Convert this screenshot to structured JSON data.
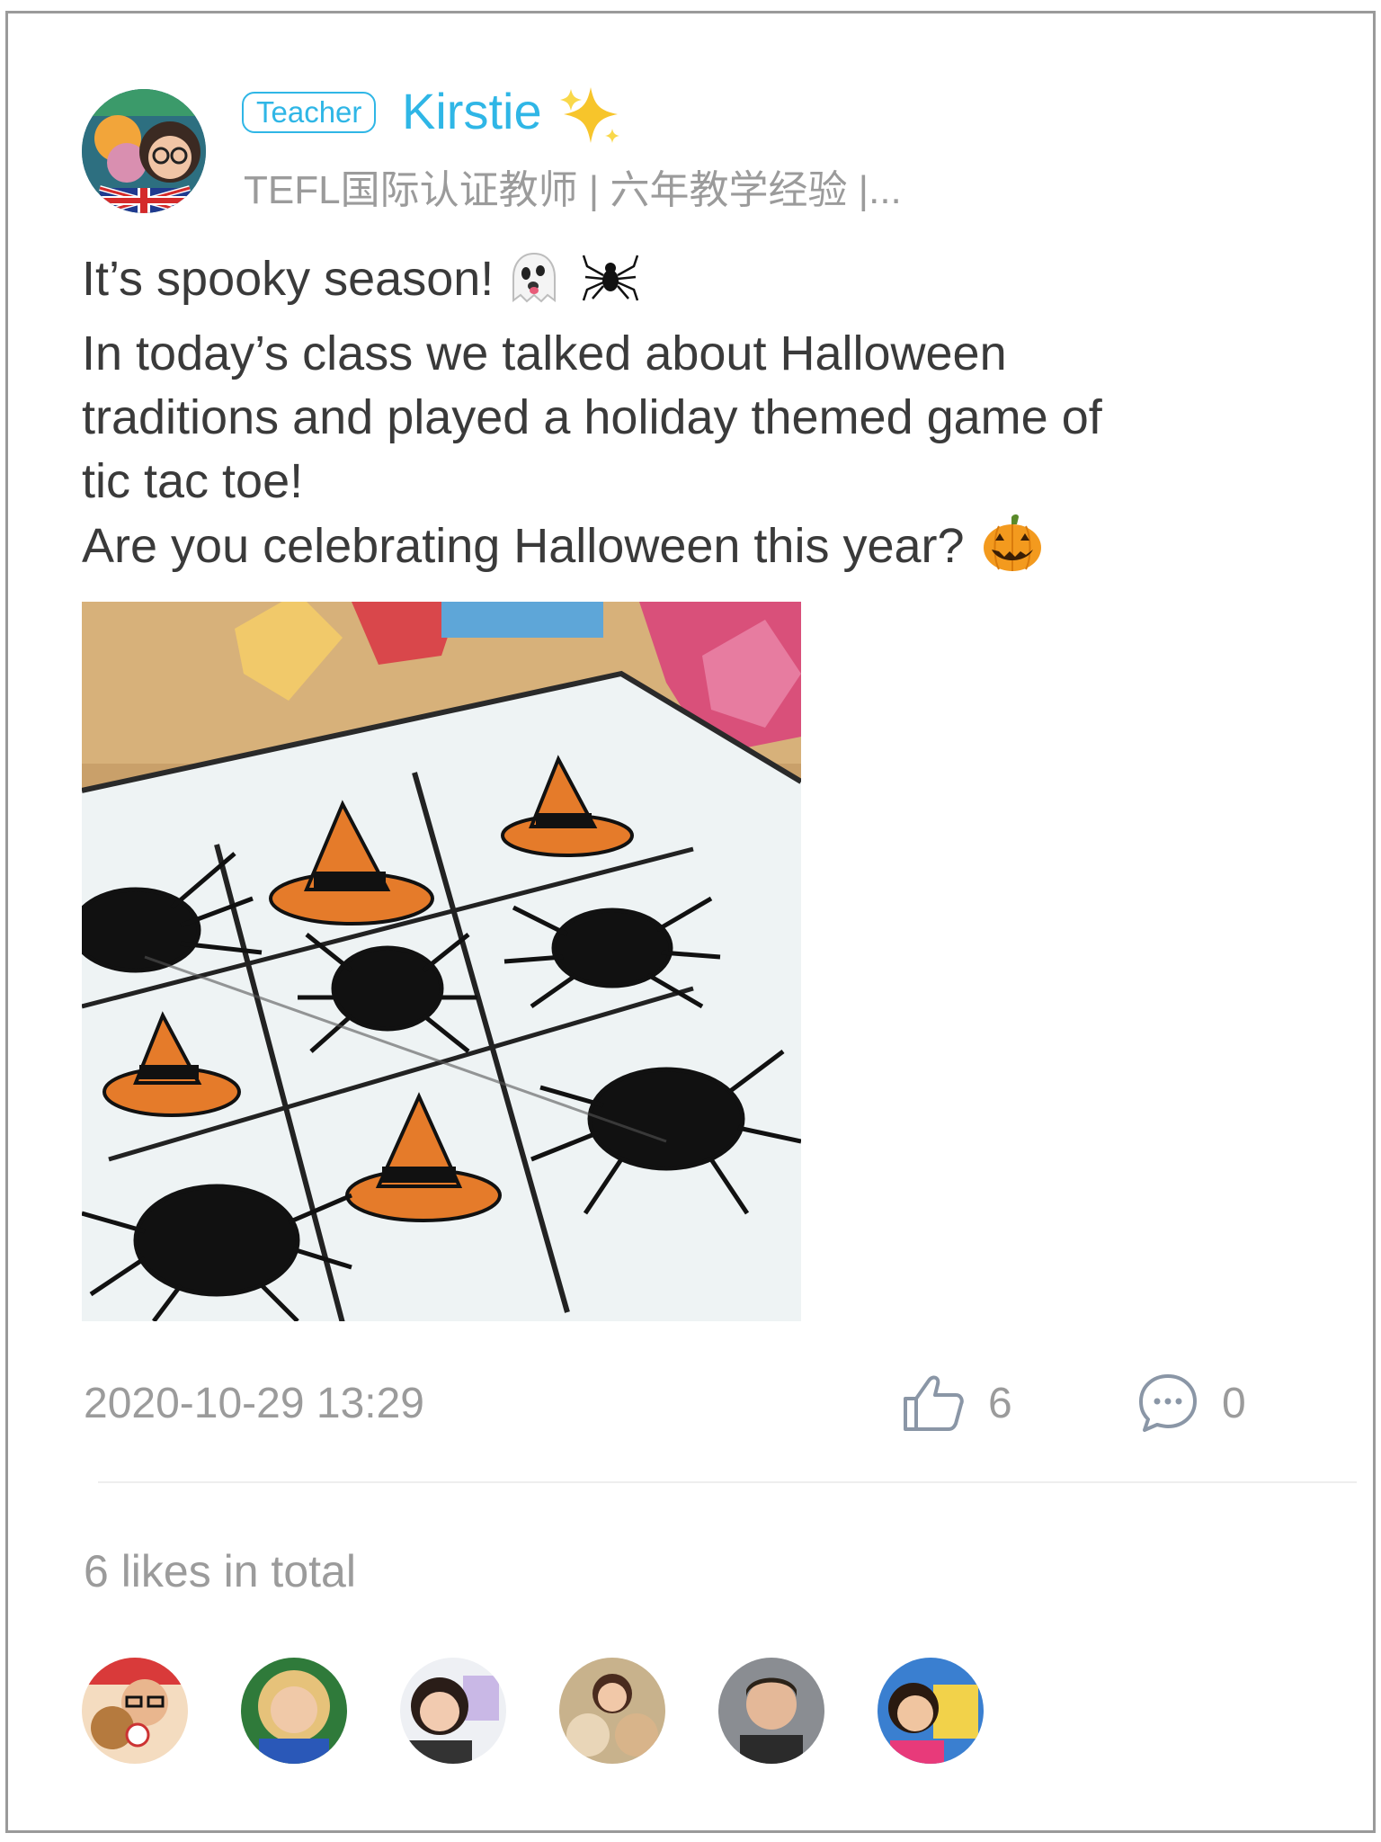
{
  "author": {
    "role_badge": "Teacher",
    "name": "Kirstie",
    "bio": "TEFL国际认证教师 | 六年教学经验 |..."
  },
  "post": {
    "lines": [
      "It’s spooky season!",
      "In today’s class we talked about Halloween",
      "traditions and played a holiday themed game of",
      "tic tac toe!",
      "Are you celebrating Halloween this year?"
    ],
    "emoji_icons": [
      "ghost-icon",
      "spider-icon",
      "jack-o-lantern-icon",
      "sparkles-icon"
    ],
    "timestamp": "2020-10-29 13:29",
    "like_count": "6",
    "comment_count": "0"
  },
  "likes": {
    "total_label": "6 likes in total",
    "likers_count": 6
  },
  "colors": {
    "accent": "#2fb6e6",
    "muted_text": "#9b9b9b",
    "body_text": "#3a3a3a",
    "icon_gray": "#8a96a6"
  }
}
